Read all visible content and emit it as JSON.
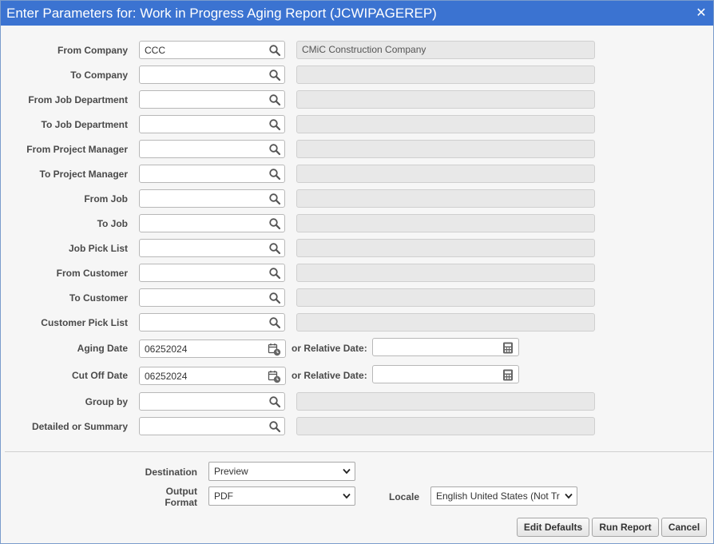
{
  "dialog": {
    "title": "Enter Parameters for: Work in Progress Aging Report (JCWIPAGEREP)",
    "close_icon": "close-icon"
  },
  "fields": {
    "from_company": {
      "label": "From Company",
      "value": "CCC",
      "description": "CMiC Construction Company"
    },
    "to_company": {
      "label": "To Company",
      "value": "",
      "description": ""
    },
    "from_job_department": {
      "label": "From Job Department",
      "value": "",
      "description": ""
    },
    "to_job_department": {
      "label": "To Job Department",
      "value": "",
      "description": ""
    },
    "from_project_manager": {
      "label": "From Project Manager",
      "value": "",
      "description": ""
    },
    "to_project_manager": {
      "label": "To Project Manager",
      "value": "",
      "description": ""
    },
    "from_job": {
      "label": "From Job",
      "value": "",
      "description": ""
    },
    "to_job": {
      "label": "To Job",
      "value": "",
      "description": ""
    },
    "job_pick_list": {
      "label": "Job Pick List",
      "value": "",
      "description": ""
    },
    "from_customer": {
      "label": "From Customer",
      "value": "",
      "description": ""
    },
    "to_customer": {
      "label": "To Customer",
      "value": "",
      "description": ""
    },
    "customer_pick_list": {
      "label": "Customer Pick List",
      "value": "",
      "description": ""
    },
    "aging_date": {
      "label": "Aging Date",
      "value": "06252024",
      "relative_label": "or Relative Date:",
      "relative_value": ""
    },
    "cut_off_date": {
      "label": "Cut Off Date",
      "value": "06252024",
      "relative_label": "or Relative Date:",
      "relative_value": ""
    },
    "group_by": {
      "label": "Group by",
      "value": "",
      "description": ""
    },
    "detailed_or_summary": {
      "label": "Detailed or Summary",
      "value": "",
      "description": ""
    }
  },
  "output": {
    "destination_label": "Destination",
    "destination_value": "Preview",
    "format_label_line1": "Output",
    "format_label_line2": "Format",
    "format_value": "PDF",
    "locale_label": "Locale",
    "locale_value": "English United States (Not Tr"
  },
  "buttons": {
    "edit_defaults": "Edit Defaults",
    "run_report": "Run Report",
    "cancel": "Cancel"
  },
  "colors": {
    "titlebar": "#3b73d1",
    "disabled_field": "#e8e8e8"
  }
}
